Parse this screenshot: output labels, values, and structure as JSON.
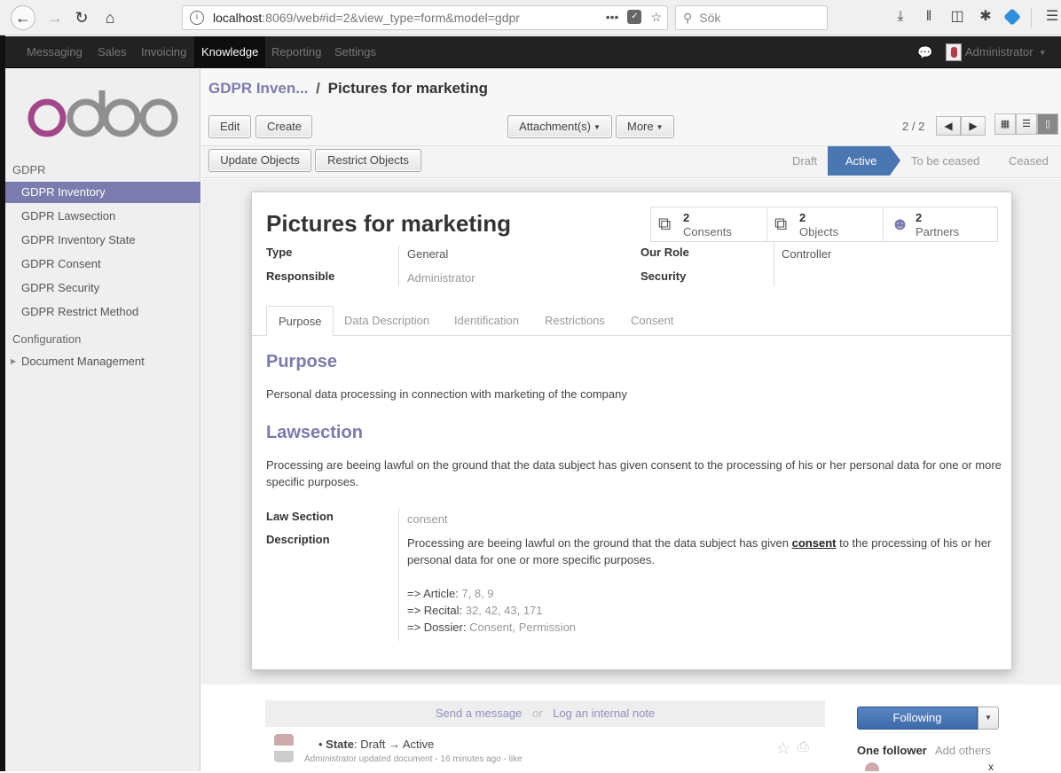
{
  "browser": {
    "url_host": "localhost",
    "url_rest": ":8069/web#id=2&view_type=form&model=gdpr",
    "search_placeholder": "Sök",
    "more_dots": "•••"
  },
  "topnav": {
    "items": [
      "Messaging",
      "Sales",
      "Invoicing",
      "Knowledge",
      "Reporting",
      "Settings"
    ],
    "active": "Knowledge",
    "user": "Administrator"
  },
  "sidebar": {
    "section_gdpr": "GDPR",
    "items": [
      {
        "label": "GDPR Inventory",
        "active": true
      },
      {
        "label": "GDPR Lawsection"
      },
      {
        "label": "GDPR Inventory State"
      },
      {
        "label": "GDPR Consent"
      },
      {
        "label": "GDPR Security"
      },
      {
        "label": "GDPR Restrict Method"
      }
    ],
    "section_config": "Configuration",
    "config_items": [
      {
        "label": "Document Management"
      }
    ]
  },
  "control_panel": {
    "breadcrumb_parent": "GDPR Inven...",
    "breadcrumb_sep": "/",
    "breadcrumb_current": "Pictures for marketing",
    "edit_label": "Edit",
    "create_label": "Create",
    "attachments_label": "Attachment(s)",
    "more_label": "More",
    "pager": "2 / 2"
  },
  "header_buttons": {
    "update_objects": "Update Objects",
    "restrict_objects": "Restrict Objects"
  },
  "stages": [
    "Draft",
    "Active",
    "To be ceased",
    "Ceased"
  ],
  "active_stage": "Active",
  "form": {
    "title": "Pictures for marketing",
    "stats": [
      {
        "count": "2",
        "label": "Consents",
        "icon": "files-icon"
      },
      {
        "count": "2",
        "label": "Objects",
        "icon": "files-icon"
      },
      {
        "count": "2",
        "label": "Partners",
        "icon": "users-icon"
      }
    ],
    "fields_left": [
      {
        "label": "Type",
        "value": "General"
      },
      {
        "label": "Responsible",
        "value": "Administrator"
      }
    ],
    "fields_right": [
      {
        "label": "Our Role",
        "value": "Controller"
      },
      {
        "label": "Security",
        "value": ""
      }
    ],
    "tabs": [
      "Purpose",
      "Data Description",
      "Identification",
      "Restrictions",
      "Consent"
    ],
    "active_tab": "Purpose",
    "purpose_heading": "Purpose",
    "purpose_text": "Personal data processing in connection with marketing of the company",
    "lawsection_heading": "Lawsection",
    "lawsection_text": "Processing are beeing lawful on the ground that the data subject has given consent to the processing of his or her personal data for one or more specific purposes.",
    "law_section_label": "Law Section",
    "law_section_value": "consent",
    "description_label": "Description",
    "description_pre": "Processing are beeing lawful on the ground that the data subject has given ",
    "description_bold": "consent",
    "description_post": " to the processing of his or her personal data for one or more specific purposes.",
    "refs": [
      {
        "prefix": "=> Article: ",
        "value": "7, 8, 9"
      },
      {
        "prefix": "=> Recital: ",
        "value": "32, 42, 43, 171"
      },
      {
        "prefix": "=> Dossier: ",
        "value": "Consent, Permission"
      }
    ]
  },
  "chatter": {
    "send_message": "Send a message",
    "or": "or",
    "log_note": "Log an internal note",
    "msg_field": "State",
    "msg_change": "Draft → Active",
    "msg_meta": "Administrator updated document - 16 minutes ago - like",
    "following_label": "Following",
    "followers_label": "One follower",
    "add_others": "Add others",
    "remove": "x"
  }
}
